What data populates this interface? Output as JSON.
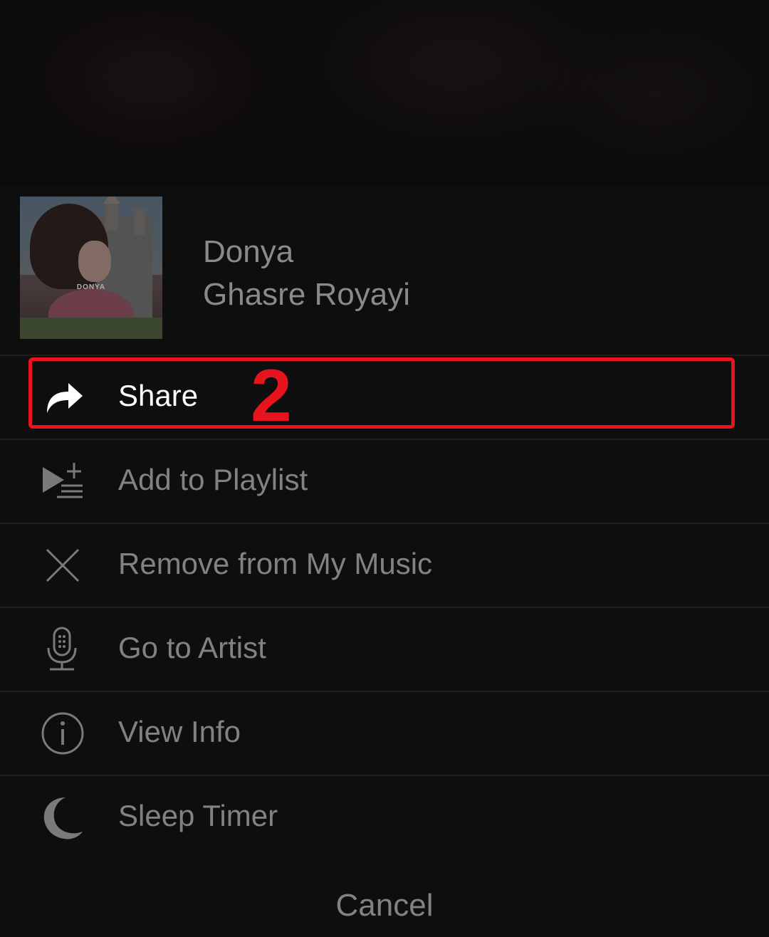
{
  "header": {
    "artist": "Donya",
    "track": "Ghasre Royayi",
    "album_art_label": "DONYA"
  },
  "menu": {
    "items": [
      {
        "label": "Share",
        "icon": "share-icon",
        "highlighted": true
      },
      {
        "label": "Add to Playlist",
        "icon": "add-to-playlist-icon"
      },
      {
        "label": "Remove from My Music",
        "icon": "close-icon"
      },
      {
        "label": "Go to Artist",
        "icon": "microphone-icon"
      },
      {
        "label": "View Info",
        "icon": "info-icon"
      },
      {
        "label": "Sleep Timer",
        "icon": "moon-icon"
      }
    ]
  },
  "annotation": {
    "step": "2",
    "color": "#e8141d"
  },
  "footer": {
    "cancel_label": "Cancel"
  }
}
